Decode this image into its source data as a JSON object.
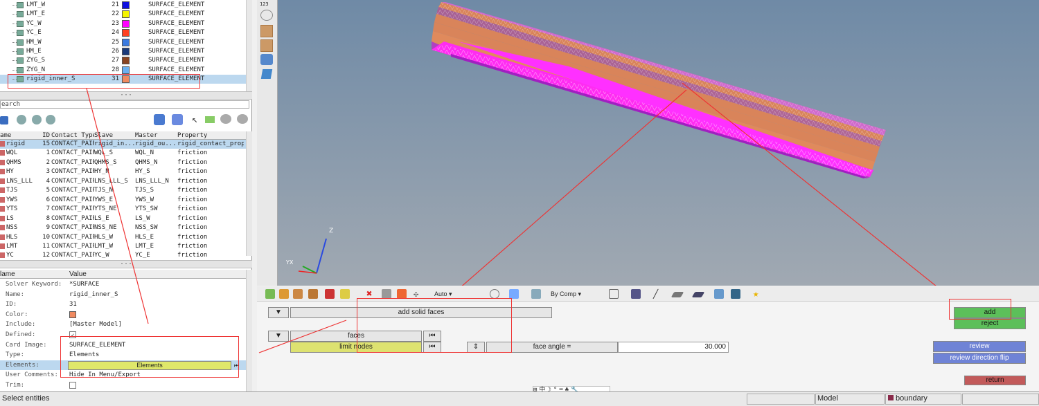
{
  "surfaces": [
    {
      "name": "LMT_W",
      "id": "21",
      "color": "#1010e0",
      "type": "SURFACE_ELEMENT"
    },
    {
      "name": "LMT_E",
      "id": "22",
      "color": "#f5f500",
      "type": "SURFACE_ELEMENT"
    },
    {
      "name": "YC_W",
      "id": "23",
      "color": "#ff00ff",
      "type": "SURFACE_ELEMENT"
    },
    {
      "name": "YC_E",
      "id": "24",
      "color": "#ff4020",
      "type": "SURFACE_ELEMENT"
    },
    {
      "name": "HM_W",
      "id": "25",
      "color": "#3a7ae0",
      "type": "SURFACE_ELEMENT"
    },
    {
      "name": "HM_E",
      "id": "26",
      "color": "#1a3a7a",
      "type": "SURFACE_ELEMENT"
    },
    {
      "name": "ZYG_S",
      "id": "27",
      "color": "#8a4420",
      "type": "SURFACE_ELEMENT"
    },
    {
      "name": "ZYG_N",
      "id": "28",
      "color": "#6ab0f0",
      "type": "SURFACE_ELEMENT"
    },
    {
      "name": "rigid_inner_S",
      "id": "31",
      "color": "#f08a60",
      "type": "SURFACE_ELEMENT"
    }
  ],
  "search_placeholder": "earch",
  "contact_headers": [
    "ame",
    "ID",
    "Contact Type",
    "Slave",
    "Master",
    "Property"
  ],
  "contacts": [
    [
      "rigid",
      "15",
      "CONTACT_PAIR",
      "rigid_in...",
      "rigid_ou...",
      "rigid_contact_proper"
    ],
    [
      "WQL",
      "1",
      "CONTACT_PAIR",
      "WQL_S",
      "WQL_N",
      "friction"
    ],
    [
      "QHMS",
      "2",
      "CONTACT_PAIR",
      "QHMS_S",
      "QHMS_N",
      "friction"
    ],
    [
      "HY",
      "3",
      "CONTACT_PAIR",
      "HY_N",
      "HY_S",
      "friction"
    ],
    [
      "LNS_LLL",
      "4",
      "CONTACT_PAIR",
      "LNS_LLL_S",
      "LNS_LLL_N",
      "friction"
    ],
    [
      "TJS",
      "5",
      "CONTACT_PAIR",
      "TJS_N",
      "TJS_S",
      "friction"
    ],
    [
      "YWS",
      "6",
      "CONTACT_PAIR",
      "YWS_E",
      "YWS_W",
      "friction"
    ],
    [
      "YTS",
      "7",
      "CONTACT_PAIR",
      "YTS_NE",
      "YTS_SW",
      "friction"
    ],
    [
      "LS",
      "8",
      "CONTACT_PAIR",
      "LS_E",
      "LS_W",
      "friction"
    ],
    [
      "NSS",
      "9",
      "CONTACT_PAIR",
      "NSS_NE",
      "NSS_SW",
      "friction"
    ],
    [
      "HLS",
      "10",
      "CONTACT_PAIR",
      "HLS_W",
      "HLS_E",
      "friction"
    ],
    [
      "LMT",
      "11",
      "CONTACT_PAIR",
      "LMT_W",
      "LMT_E",
      "friction"
    ],
    [
      "YC",
      "12",
      "CONTACT_PAIR",
      "YC_W",
      "YC_E",
      "friction"
    ]
  ],
  "props_header": {
    "name": "lame",
    "value": "Value"
  },
  "props": [
    {
      "k": "Solver Keyword:",
      "v": "*SURFACE"
    },
    {
      "k": "Name:",
      "v": "rigid_inner_S"
    },
    {
      "k": "ID:",
      "v": "31"
    },
    {
      "k": "Color:",
      "v": ""
    },
    {
      "k": "Include:",
      "v": "[Master Model]"
    },
    {
      "k": "Defined:",
      "v": ""
    },
    {
      "k": "Card Image:",
      "v": "SURFACE_ELEMENT"
    },
    {
      "k": "Type:",
      "v": "Elements"
    },
    {
      "k": "Elements:",
      "v": "Elements"
    },
    {
      "k": "User Comments:",
      "v": "Hide In Menu/Export"
    },
    {
      "k": "Trim:",
      "v": ""
    }
  ],
  "prop_color": "#f08a60",
  "viewport": {
    "axis_z": "Z",
    "axis_xy": "YX",
    "toolbar_badge": "123"
  },
  "toolbar": {
    "auto": "Auto",
    "by_comp": "By Comp"
  },
  "panel": {
    "mode": "add solid faces",
    "faces": "faces",
    "limit": "limit nodes",
    "face_angle_label": "face angle =",
    "face_angle_value": "30.000",
    "add": "add",
    "reject": "reject",
    "review": "review",
    "review_flip": "review direction flip",
    "return": "return"
  },
  "status": {
    "message": "Select entities",
    "model": "Model",
    "component": "boundary"
  }
}
